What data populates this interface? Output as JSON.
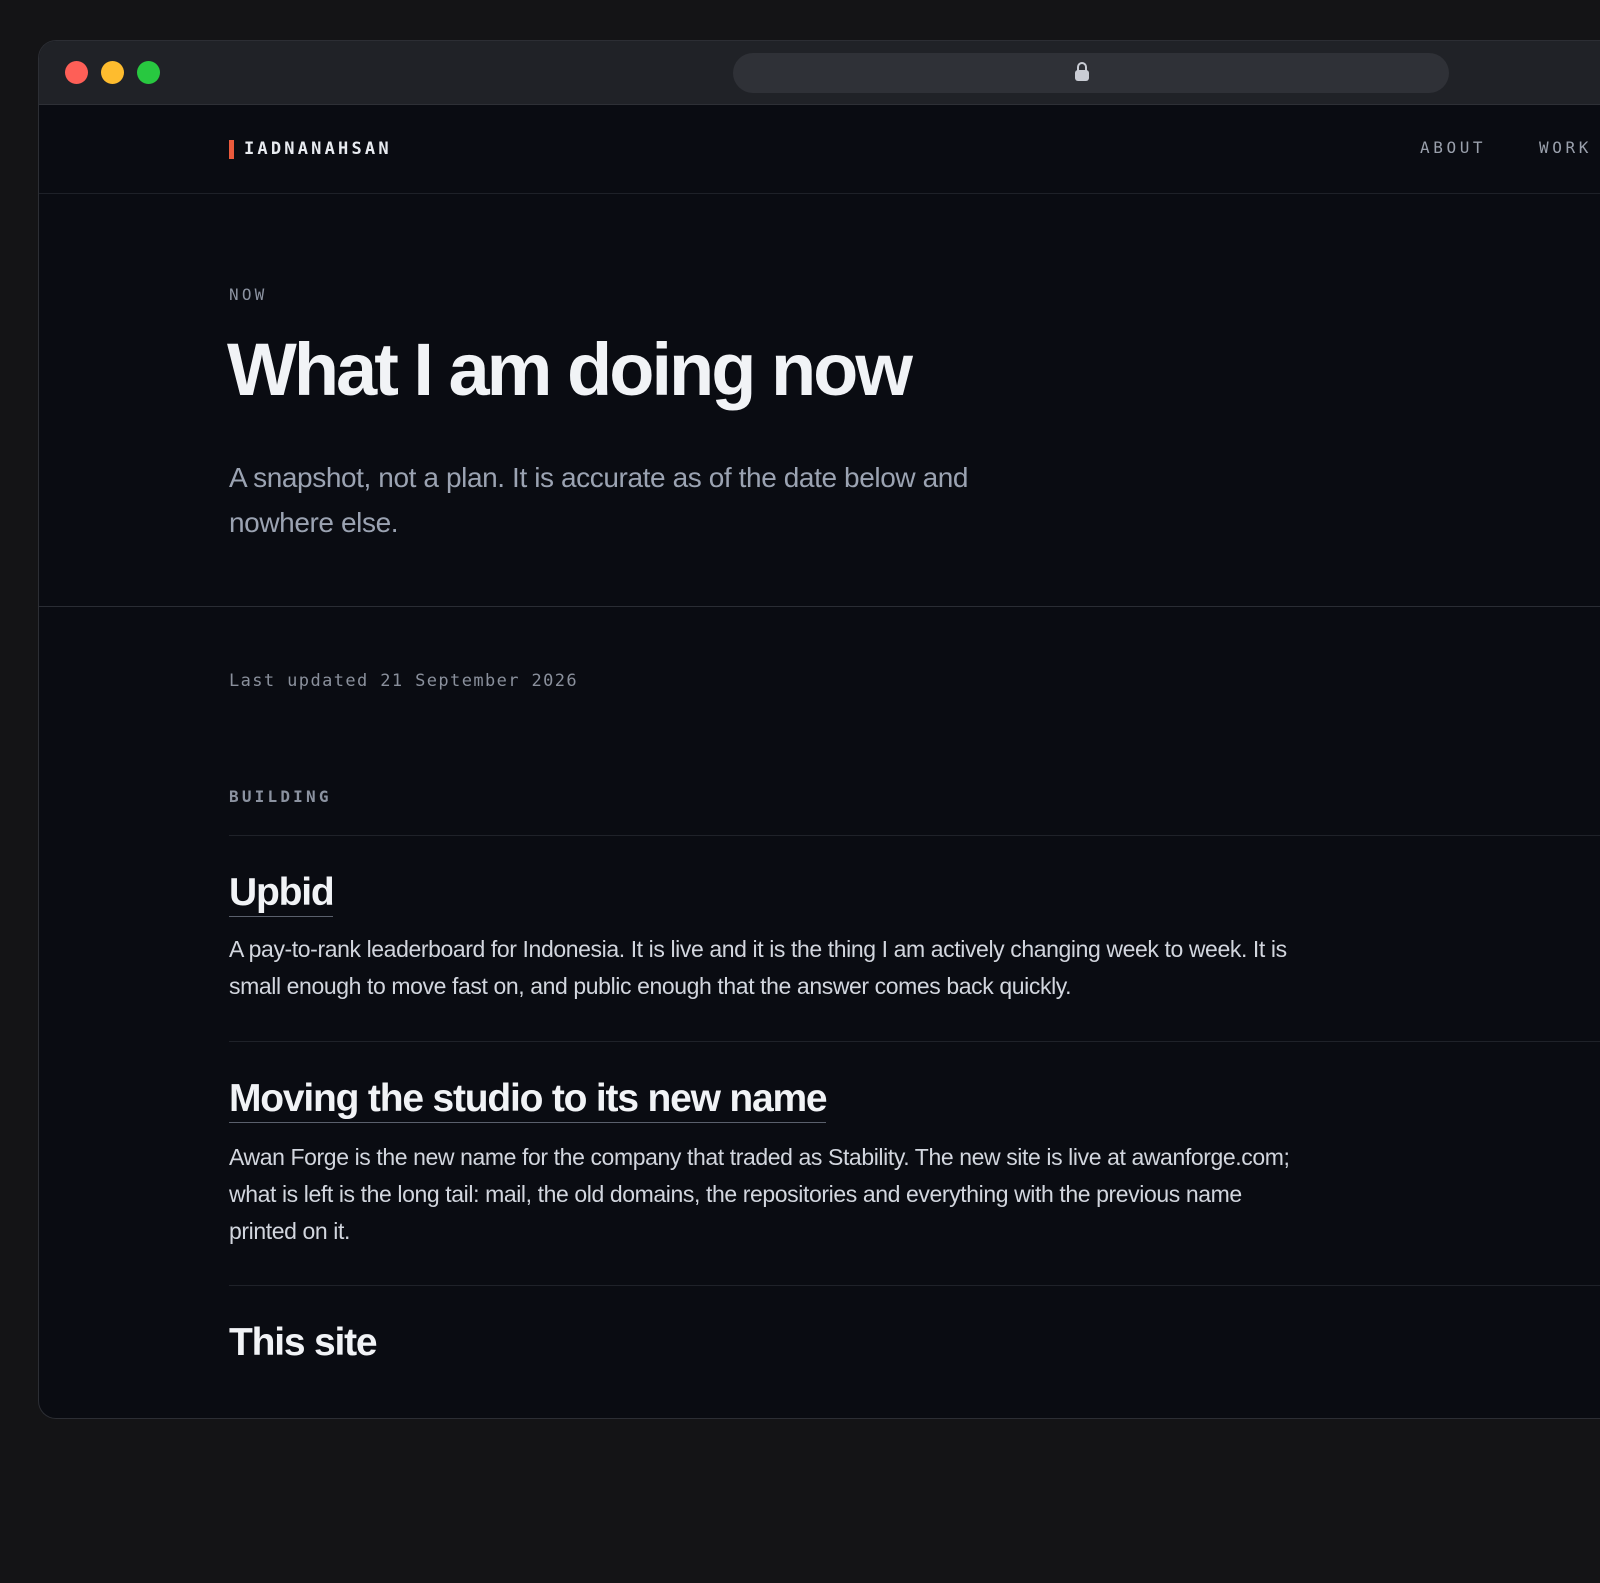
{
  "site": {
    "brand": "IADNANAHSAN",
    "nav": [
      {
        "label": "ABOUT"
      },
      {
        "label": "WORK"
      }
    ]
  },
  "hero": {
    "eyebrow": "NOW",
    "title": "What I am doing now",
    "subtitle": "A snapshot, not a plan. It is accurate as of the date below and nowhere else."
  },
  "updated": "Last updated 21 September 2026",
  "section": {
    "label": "BUILDING",
    "items": [
      {
        "title": "Upbid",
        "description": "A pay-to-rank leaderboard for Indonesia. It is live and it is the thing I am actively changing week to week. It is small enough to move fast on, and public enough that the answer comes back quickly."
      },
      {
        "title": "Moving the studio to its new name",
        "description": "Awan Forge is the new name for the company that traded as Stability. The new site is live at awanforge.com; what is left is the long tail: mail, the old domains, the repositories and everything with the previous name printed on it."
      },
      {
        "title": "This site"
      }
    ]
  },
  "colors": {
    "accent": "#ea5a3c",
    "background": "#0a0c12",
    "text": "#f1f3f6",
    "muted": "#8b92a0"
  }
}
